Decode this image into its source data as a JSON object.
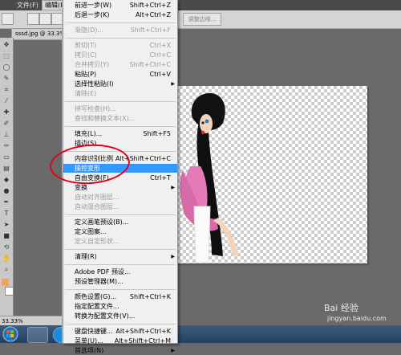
{
  "menubar": {
    "items": [
      "文件(F)",
      "编辑(E)"
    ]
  },
  "doc_tab": "sssd.jpg @ 33.3%",
  "options": {
    "refine_edge": "调整边缘..."
  },
  "status": {
    "zoom": "33.33%"
  },
  "edit_menu": {
    "items": [
      {
        "label": "前进一步(W)",
        "shortcut": "Shift+Ctrl+Z",
        "disabled": false
      },
      {
        "label": "后退一步(K)",
        "shortcut": "Alt+Ctrl+Z",
        "disabled": false
      },
      {
        "sep": true
      },
      {
        "label": "渐隐(D)...",
        "shortcut": "Shift+Ctrl+F",
        "disabled": true
      },
      {
        "sep": true
      },
      {
        "label": "剪切(T)",
        "shortcut": "Ctrl+X",
        "disabled": true
      },
      {
        "label": "拷贝(C)",
        "shortcut": "Ctrl+C",
        "disabled": true
      },
      {
        "label": "合并拷贝(Y)",
        "shortcut": "Shift+Ctrl+C",
        "disabled": true
      },
      {
        "label": "粘贴(P)",
        "shortcut": "Ctrl+V",
        "disabled": false
      },
      {
        "label": "选择性粘贴(I)",
        "shortcut": "",
        "submenu": true,
        "disabled": false
      },
      {
        "label": "清除(E)",
        "shortcut": "",
        "disabled": true
      },
      {
        "sep": true
      },
      {
        "label": "拼写检查(H)...",
        "shortcut": "",
        "disabled": true
      },
      {
        "label": "查找和替换文本(X)...",
        "shortcut": "",
        "disabled": true
      },
      {
        "sep": true
      },
      {
        "label": "填充(L)...",
        "shortcut": "Shift+F5",
        "disabled": false
      },
      {
        "label": "描边(S)...",
        "shortcut": "",
        "disabled": false
      },
      {
        "sep": true
      },
      {
        "label": "内容识别比例",
        "shortcut": "Alt+Shift+Ctrl+C",
        "disabled": false
      },
      {
        "label": "操控变形",
        "shortcut": "",
        "disabled": false,
        "highlight": true
      },
      {
        "label": "自由变换(F)",
        "shortcut": "Ctrl+T",
        "disabled": false
      },
      {
        "label": "变换",
        "shortcut": "",
        "submenu": true,
        "disabled": false
      },
      {
        "label": "自动对齐图层...",
        "shortcut": "",
        "disabled": true
      },
      {
        "label": "自动混合图层...",
        "shortcut": "",
        "disabled": true
      },
      {
        "sep": true
      },
      {
        "label": "定义画笔预设(B)...",
        "shortcut": "",
        "disabled": false
      },
      {
        "label": "定义图案...",
        "shortcut": "",
        "disabled": false
      },
      {
        "label": "定义自定形状...",
        "shortcut": "",
        "disabled": true
      },
      {
        "sep": true
      },
      {
        "label": "清理(R)",
        "shortcut": "",
        "submenu": true,
        "disabled": false
      },
      {
        "sep": true
      },
      {
        "label": "Adobe PDF 预设...",
        "shortcut": "",
        "disabled": false
      },
      {
        "label": "预设管理器(M)...",
        "shortcut": "",
        "disabled": false
      },
      {
        "sep": true
      },
      {
        "label": "颜色设置(G)...",
        "shortcut": "Shift+Ctrl+K",
        "disabled": false
      },
      {
        "label": "指定配置文件...",
        "shortcut": "",
        "disabled": false
      },
      {
        "label": "转换为配置文件(V)...",
        "shortcut": "",
        "disabled": false
      },
      {
        "sep": true
      },
      {
        "label": "键盘快捷键...",
        "shortcut": "Alt+Shift+Ctrl+K",
        "disabled": false
      },
      {
        "label": "菜单(U)...",
        "shortcut": "Alt+Shift+Ctrl+M",
        "disabled": false
      },
      {
        "label": "首选项(N)",
        "shortcut": "",
        "submenu": true,
        "disabled": false
      }
    ]
  },
  "watermark": {
    "brand": "Bai 经验",
    "url": "jingyan.baidu.com"
  },
  "colors": {
    "highlight": "#3399ff",
    "annotation": "#e6001e",
    "fg_swatch": "#f2a35a",
    "bg_swatch": "#ffffff"
  }
}
